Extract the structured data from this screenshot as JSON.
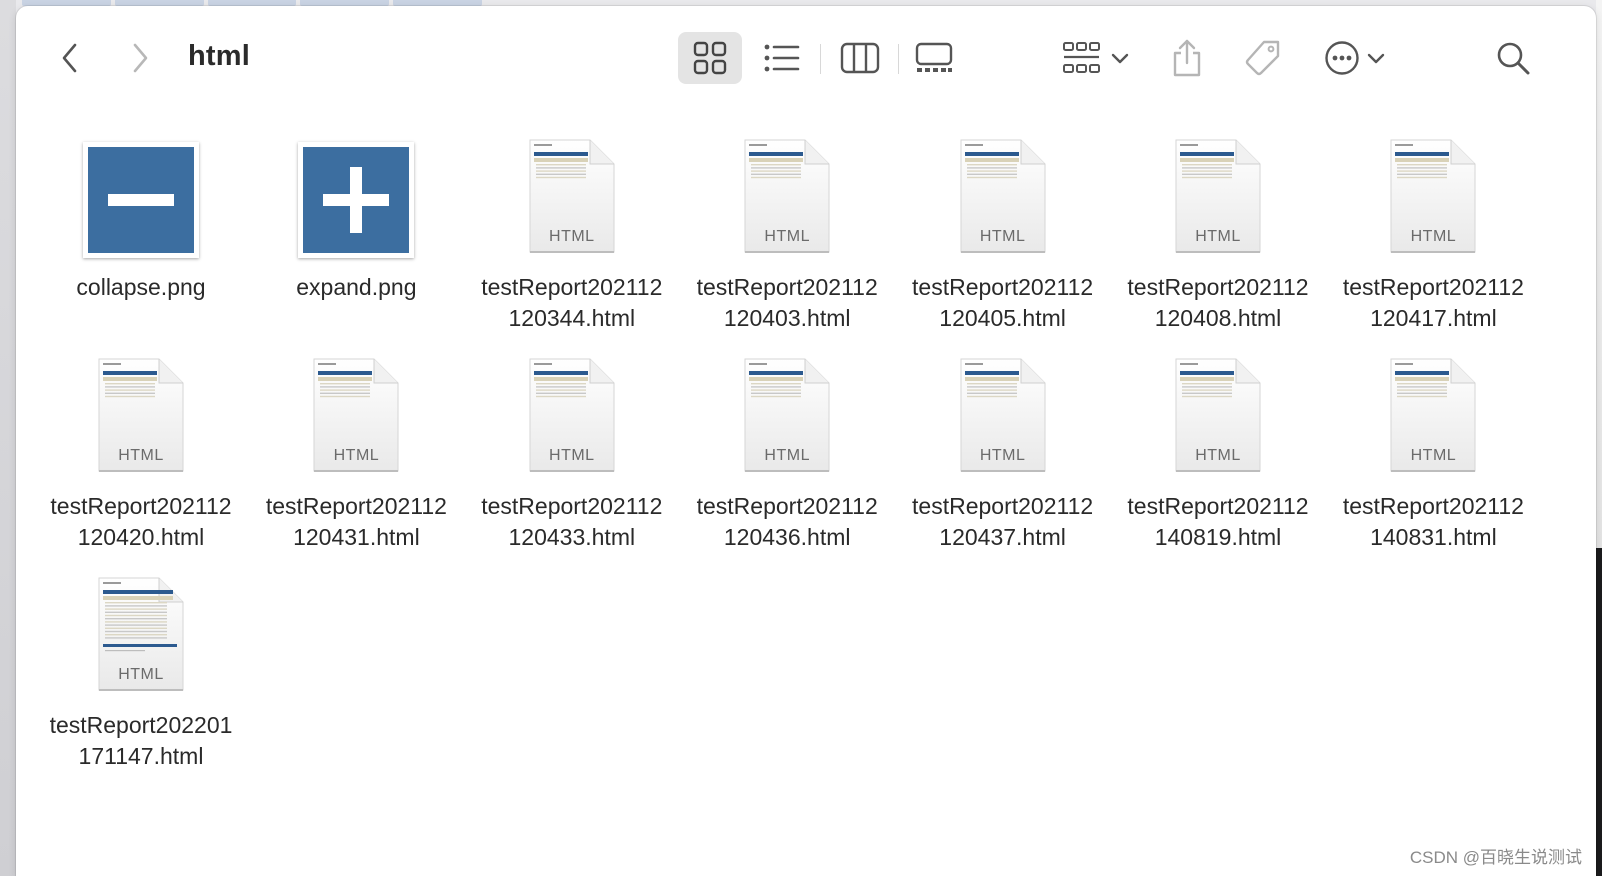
{
  "window": {
    "title": "html"
  },
  "toolbar": {
    "back_icon": "chevron-left-icon",
    "forward_icon": "chevron-right-icon",
    "views": [
      "icon-view-icon",
      "list-view-icon",
      "column-view-icon",
      "gallery-view-icon"
    ],
    "active_view": "icon-view-icon",
    "group_icon": "group-grid-icon",
    "share_icon": "share-icon",
    "tag_icon": "tag-icon",
    "more_icon": "ellipsis-circle-icon",
    "search_icon": "search-icon"
  },
  "colors": {
    "png_blue": "#3c6ea0",
    "active_view_bg": "#e4e4e4"
  },
  "files": [
    {
      "type": "png",
      "symbol": "minus",
      "name": [
        "collapse.png"
      ]
    },
    {
      "type": "png",
      "symbol": "plus",
      "name": [
        "expand.png"
      ]
    },
    {
      "type": "html",
      "ext": "HTML",
      "name": [
        "testReport202112",
        "120344.html"
      ]
    },
    {
      "type": "html",
      "ext": "HTML",
      "name": [
        "testReport202112",
        "120403.html"
      ]
    },
    {
      "type": "html",
      "ext": "HTML",
      "name": [
        "testReport202112",
        "120405.html"
      ]
    },
    {
      "type": "html",
      "ext": "HTML",
      "name": [
        "testReport202112",
        "120408.html"
      ]
    },
    {
      "type": "html",
      "ext": "HTML",
      "name": [
        "testReport202112",
        "120417.html"
      ]
    },
    {
      "type": "html",
      "ext": "HTML",
      "name": [
        "testReport202112",
        "120420.html"
      ]
    },
    {
      "type": "html",
      "ext": "HTML",
      "name": [
        "testReport202112",
        "120431.html"
      ]
    },
    {
      "type": "html",
      "ext": "HTML",
      "name": [
        "testReport202112",
        "120433.html"
      ]
    },
    {
      "type": "html",
      "ext": "HTML",
      "name": [
        "testReport202112",
        "120436.html"
      ]
    },
    {
      "type": "html",
      "ext": "HTML",
      "name": [
        "testReport202112",
        "120437.html"
      ]
    },
    {
      "type": "html",
      "ext": "HTML",
      "name": [
        "testReport202112",
        "140819.html"
      ]
    },
    {
      "type": "html",
      "ext": "HTML",
      "name": [
        "testReport202112",
        "140831.html"
      ]
    },
    {
      "type": "html",
      "ext": "HTML",
      "tall": true,
      "name": [
        "testReport202201",
        "171147.html"
      ]
    }
  ],
  "watermark": "CSDN @百晓生说测试"
}
